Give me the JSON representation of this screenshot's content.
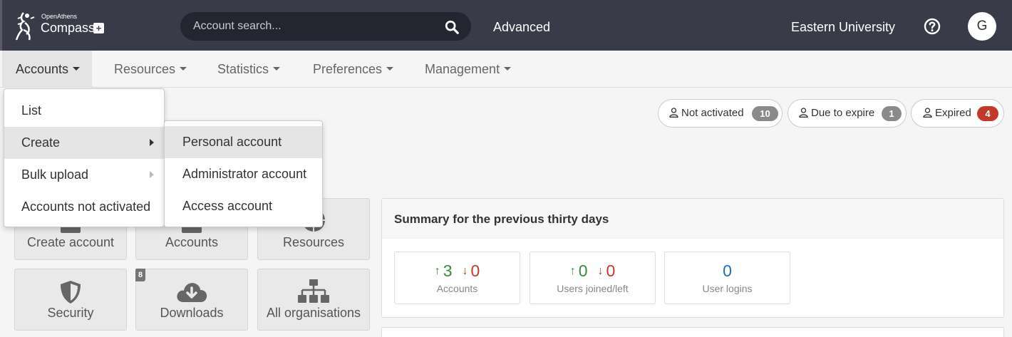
{
  "header": {
    "logo_small": "OpenAthens",
    "logo_big": "Compass",
    "search_placeholder": "Account search...",
    "advanced_label": "Advanced",
    "organisation": "Eastern University",
    "avatar_initial": "G"
  },
  "nav": {
    "items": [
      {
        "label": "Accounts",
        "active": true
      },
      {
        "label": "Resources"
      },
      {
        "label": "Statistics"
      },
      {
        "label": "Preferences"
      },
      {
        "label": "Management"
      }
    ]
  },
  "accounts_menu": {
    "items": [
      {
        "label": "List"
      },
      {
        "label": "Create",
        "highlighted": true,
        "has_submenu": true
      },
      {
        "label": "Bulk upload",
        "has_submenu": true
      },
      {
        "label": "Accounts not activated"
      }
    ],
    "create_submenu": [
      {
        "label": "Personal account",
        "highlighted": true
      },
      {
        "label": "Administrator account"
      },
      {
        "label": "Access account"
      }
    ]
  },
  "status_pills": [
    {
      "label": "Not activated",
      "count": "10",
      "color": "#8a8a8a"
    },
    {
      "label": "Due to expire",
      "count": "1",
      "color": "#8a8a8a"
    },
    {
      "label": "Expired",
      "count": "4",
      "color": "#c0392b"
    }
  ],
  "tiles": [
    {
      "label": "Create account",
      "icon": "user-plus-icon"
    },
    {
      "label": "Accounts",
      "icon": "users-icon"
    },
    {
      "label": "Resources",
      "icon": "globe-icon"
    },
    {
      "label": "Security",
      "icon": "shield-icon"
    },
    {
      "label": "Downloads",
      "icon": "cloud-download-icon",
      "badge": "8"
    },
    {
      "label": "All organisations",
      "icon": "sitemap-icon"
    }
  ],
  "summary": {
    "title": "Summary for the previous thirty days",
    "stats": [
      {
        "label": "Accounts",
        "up": "3",
        "down": "0"
      },
      {
        "label": "Users joined/left",
        "up": "0",
        "down": "0"
      },
      {
        "label": "User logins",
        "value": "0"
      }
    ]
  },
  "colors": {
    "header_bg": "#3a3b48",
    "search_bg": "#232631",
    "up": "#3b8a3e",
    "down": "#c0392b",
    "logins": "#1f6fb2"
  }
}
